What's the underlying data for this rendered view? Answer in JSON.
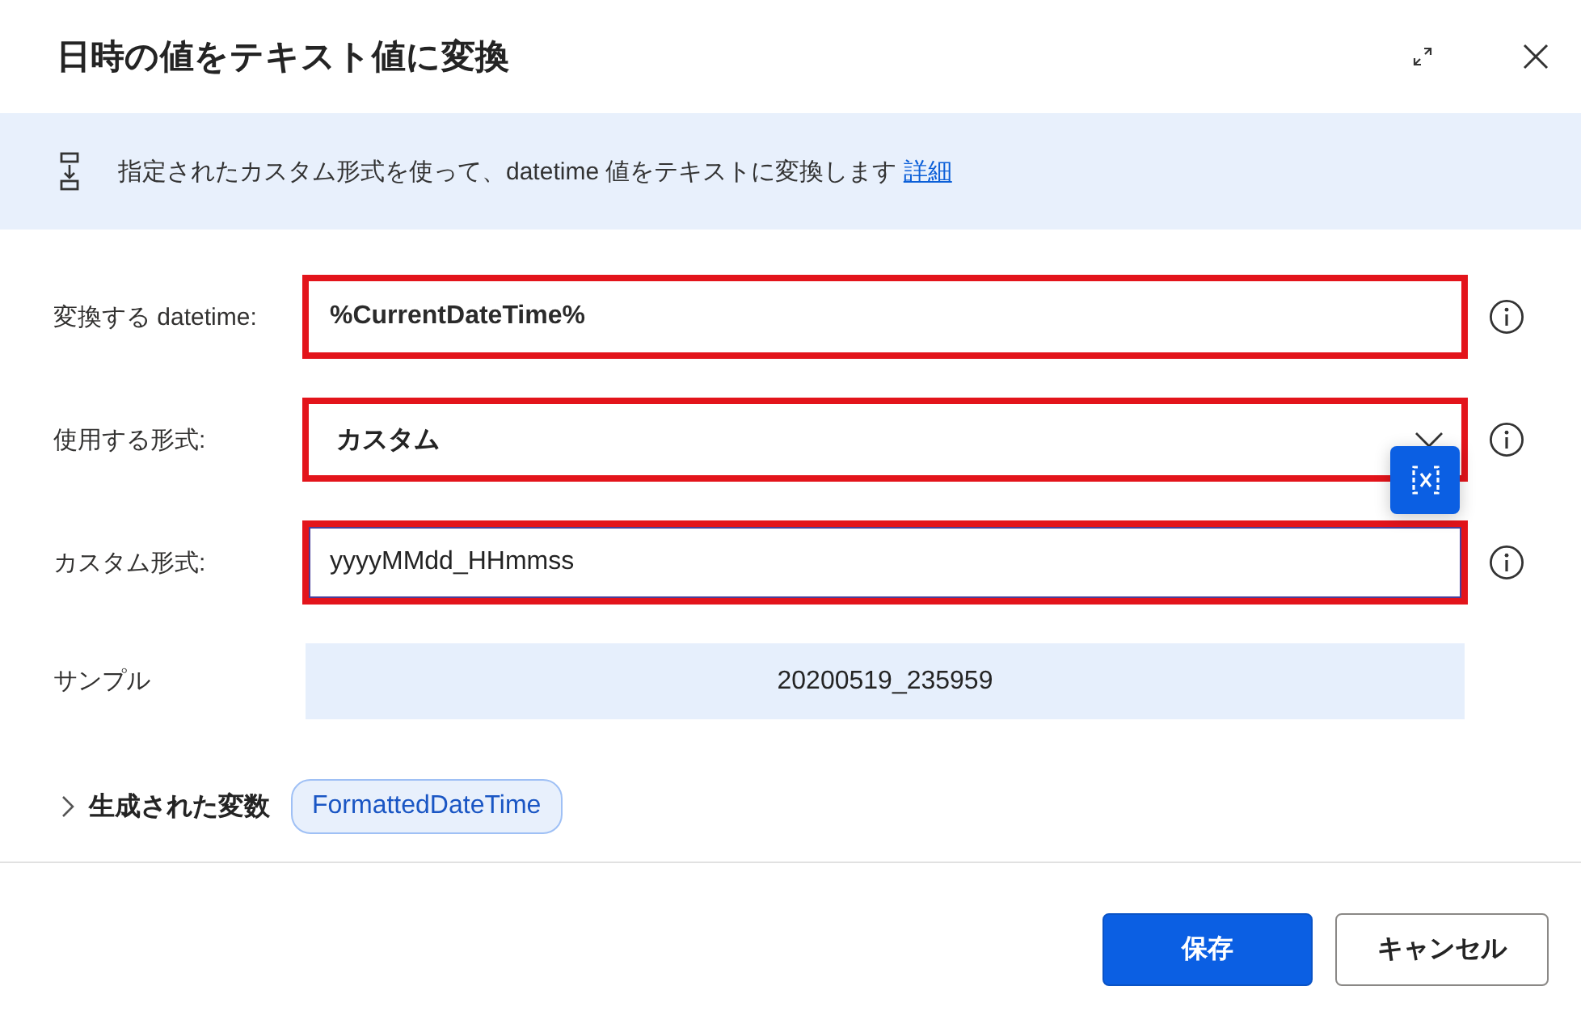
{
  "dialog": {
    "title": "日時の値をテキスト値に変換"
  },
  "banner": {
    "text": "指定されたカスタム形式を使って、datetime 値をテキストに変換します",
    "link": "詳細"
  },
  "fields": [
    {
      "kind": "variable",
      "label": "変換する datetime:",
      "value": "%CurrentDateTime%",
      "highlighted": true,
      "focused": false
    },
    {
      "kind": "select",
      "label": "使用する形式:",
      "value": "カスタム",
      "highlighted": true,
      "focused": false
    },
    {
      "kind": "text",
      "label": "カスタム形式:",
      "value": "yyyyMMdd_HHmmss",
      "highlighted": true,
      "focused": true
    },
    {
      "kind": "readout",
      "label": "サンプル",
      "value": "20200519_235959",
      "highlighted": false,
      "focused": false
    }
  ],
  "output": {
    "label": "生成された変数",
    "expanded": false,
    "variables": [
      "FormattedDateTime"
    ]
  },
  "buttons": [
    {
      "label": "保存",
      "kind": "primary"
    },
    {
      "label": "キャンセル",
      "kind": "secondary"
    }
  ]
}
